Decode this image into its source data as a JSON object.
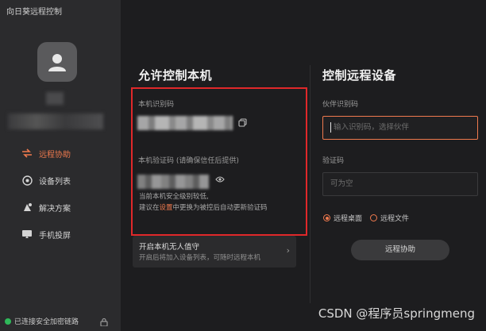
{
  "app": {
    "title": "向日葵远程控制",
    "window_controls": [
      "≡",
      "—",
      "▢",
      "✕"
    ]
  },
  "sidebar": {
    "items": [
      {
        "label": "远程协助",
        "icon": "remote-assist-icon",
        "active": true
      },
      {
        "label": "设备列表",
        "icon": "device-list-icon",
        "active": false
      },
      {
        "label": "解决方案",
        "icon": "solutions-icon",
        "active": false
      },
      {
        "label": "手机投屏",
        "icon": "screen-cast-icon",
        "active": false
      }
    ],
    "status": "已连接安全加密链路"
  },
  "allow": {
    "title": "允许控制本机",
    "id_label": "本机识别码",
    "code_label": "本机验证码 (请确保信任后提供)",
    "hint_line1": "当前本机安全级别较低,",
    "hint_line2_prefix": "建议在",
    "hint_link": "设置",
    "hint_line2_suffix": "中更换为被控后自动更新验证码",
    "unattended_title": "开启本机无人值守",
    "unattended_desc": "开启后将加入设备列表，可随时远程本机"
  },
  "control": {
    "title": "控制远程设备",
    "partner_label": "伙伴识别码",
    "partner_placeholder": "输入识别码，选择伙伴",
    "code_label": "验证码",
    "code_placeholder": "可为空",
    "radio_desktop": "远程桌面",
    "radio_files": "远程文件",
    "connect_button": "远程协助"
  },
  "watermark": "CSDN @程序员springmeng",
  "colors": {
    "accent": "#f07a4e",
    "highlight_box": "#e0282a",
    "online": "#2fb95a"
  }
}
